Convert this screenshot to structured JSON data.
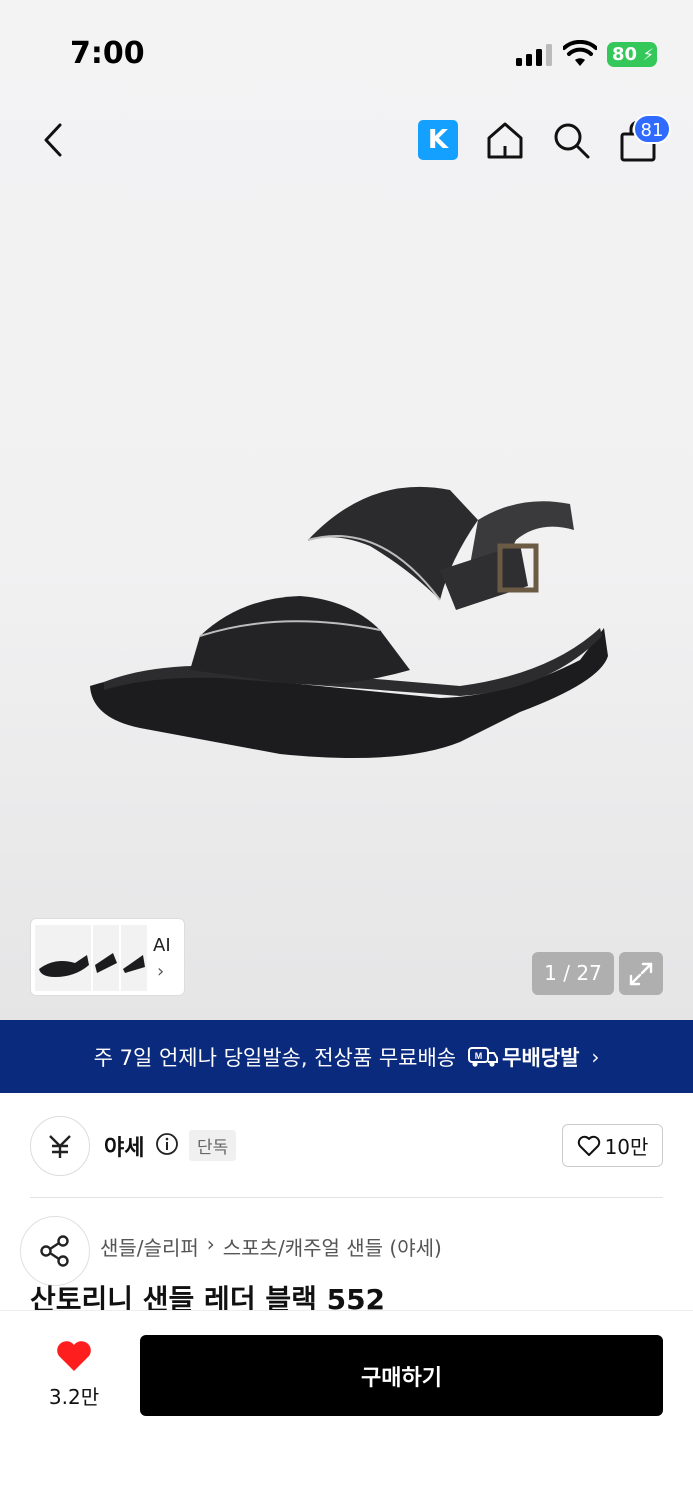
{
  "status": {
    "time": "7:00",
    "battery": "80"
  },
  "nav": {
    "k_label": "K",
    "cart_count": "81"
  },
  "gallery": {
    "ai_label": "AI",
    "page_counter": "1 / 27"
  },
  "banner": {
    "text": "주 7일 언제나 당일발송, 전상품 무료배송",
    "brand": "무배당발"
  },
  "store": {
    "name": "야세",
    "exclusive_badge": "단독",
    "likes": "10만"
  },
  "product": {
    "breadcrumb": [
      "샌들/슬리퍼",
      "스포츠/캐주얼 샌들 (야세)"
    ],
    "title": "산토리니 샌들 레더 블랙 552"
  },
  "bottom": {
    "wish_count": "3.2만",
    "buy_label": "구매하기"
  },
  "colors": {
    "banner_bg": "#0a2a7e",
    "badge_blue": "#2f6bff",
    "k_logo": "#14a0ff",
    "heart_red": "#ff1e1e",
    "battery_green": "#34c759"
  },
  "icons": [
    "back-icon",
    "home-icon",
    "search-icon",
    "bag-icon",
    "expand-icon",
    "info-icon",
    "heart-icon",
    "share-icon",
    "truck-icon"
  ]
}
